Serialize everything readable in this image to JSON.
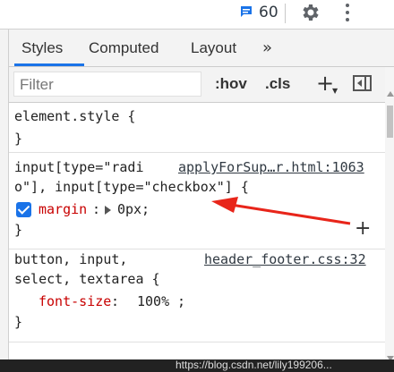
{
  "topbar": {
    "message_count": "60"
  },
  "tabs": [
    {
      "label": "Styles",
      "active": true
    },
    {
      "label": "Computed",
      "active": false
    },
    {
      "label": "Layout",
      "active": false
    }
  ],
  "tabs_overflow": "»",
  "filter": {
    "placeholder": "Filter",
    "hov": ":hov",
    "cls": ".cls"
  },
  "rules": {
    "element_style": {
      "selector": "element.style {",
      "close": "}"
    },
    "checkbox_rule": {
      "selector_line1": "input[type=\"radi",
      "selector_line2": "o\"], input[type=\"checkbox\"] {",
      "source": "applyForSup…r.html:1063",
      "prop_name": "margin",
      "colon": ":",
      "prop_value": "0px",
      "semicolon": ";",
      "close": "}",
      "checked": true
    },
    "button_rule": {
      "selector_line1": "button, input,",
      "selector_line2": "select, textarea {",
      "source": "header_footer.css:32",
      "prop_name": "font-size",
      "prop_value": "100%",
      "close": "}"
    }
  },
  "watermark": "https://blog.csdn.net/lily199206...",
  "colors": {
    "accent": "#1a73e8",
    "prop": "#c80000",
    "annotation_arrow": "#e8251a"
  }
}
